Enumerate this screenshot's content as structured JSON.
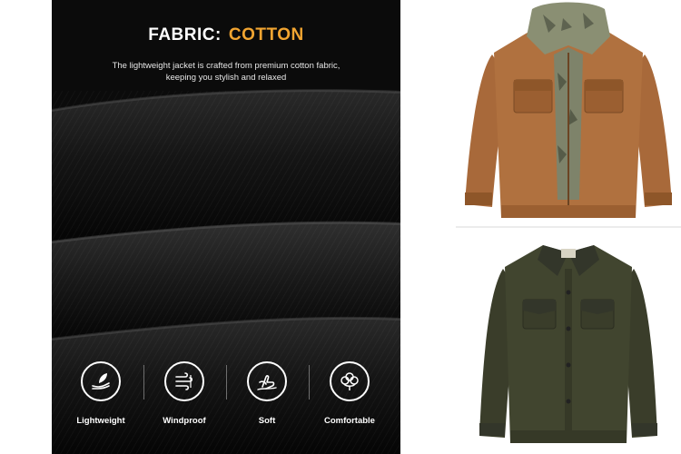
{
  "fabric": {
    "label": "FABRIC",
    "separator": ":",
    "value": "COTTON",
    "description_line1": "The lightweight jacket is crafted from premium cotton fabric,",
    "description_line2": "keeping you stylish and relaxed"
  },
  "features": [
    {
      "label": "Lightweight",
      "icon": "feather-hand-icon"
    },
    {
      "label": "Windproof",
      "icon": "wind-icon"
    },
    {
      "label": "Soft",
      "icon": "hand-touch-icon"
    },
    {
      "label": "Comfortable",
      "icon": "cotton-flower-icon"
    }
  ],
  "colors": {
    "accent": "#f2a531",
    "panel_bg": "#0b0b0b",
    "jacket_tan": "#a8693a",
    "jacket_olive": "#3a3d2a"
  },
  "products": [
    {
      "name": "tan-hooded-jacket"
    },
    {
      "name": "olive-green-jacket"
    }
  ]
}
